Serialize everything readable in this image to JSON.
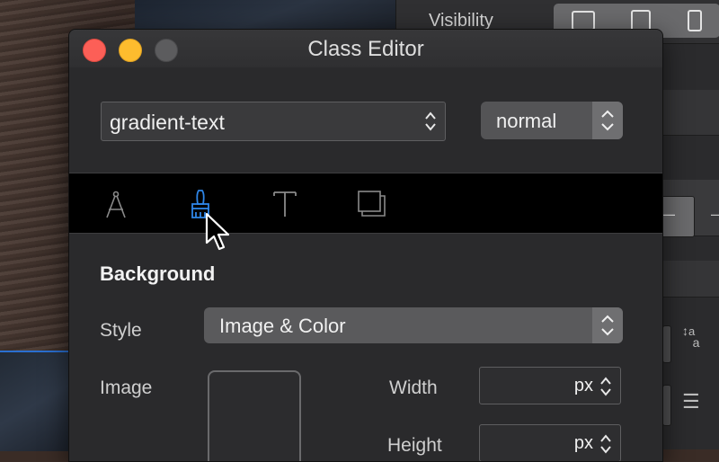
{
  "inspector": {
    "visibility_label": "Visibility"
  },
  "window": {
    "title": "Class Editor"
  },
  "class_selector": {
    "value": "gradient-text"
  },
  "state_selector": {
    "value": "normal"
  },
  "tabs": [
    {
      "name": "layout",
      "icon": "compass-icon",
      "active": false
    },
    {
      "name": "style",
      "icon": "brush-icon",
      "active": true
    },
    {
      "name": "text",
      "icon": "text-icon",
      "active": false
    },
    {
      "name": "effects",
      "icon": "shadow-icon",
      "active": false
    }
  ],
  "background_section": {
    "title": "Background",
    "style_label": "Style",
    "style_value": "Image & Color",
    "image_label": "Image",
    "width_label": "Width",
    "width_unit": "px",
    "height_label": "Height",
    "height_unit": "px"
  },
  "colors": {
    "accent": "#2e86e8",
    "window_bg": "#2a2a2c",
    "tabbar_bg": "#000000"
  }
}
